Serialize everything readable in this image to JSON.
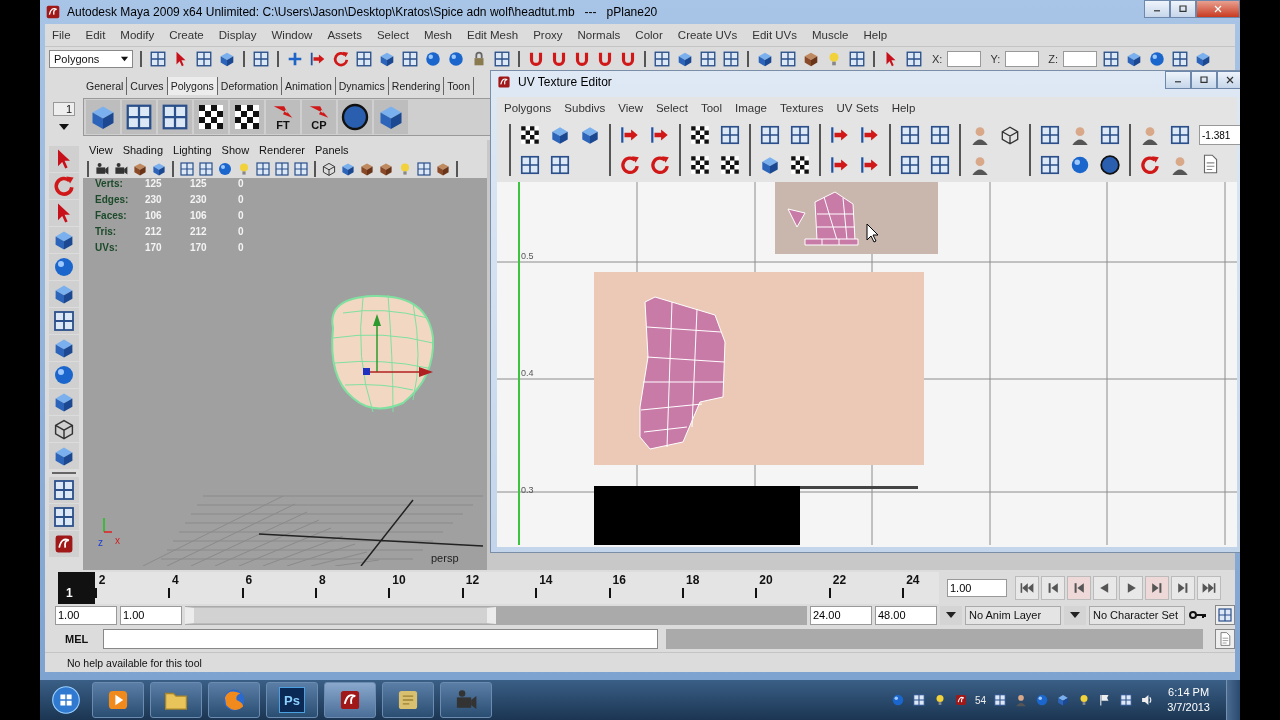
{
  "window": {
    "title": "Autodesk Maya 2009 x64 Unlimited: C:\\Users\\Jason\\Desktop\\Kratos\\Spice adn wolf\\headtut.mb   ---   pPlane20"
  },
  "menu": [
    "File",
    "Edit",
    "Modify",
    "Create",
    "Display",
    "Window",
    "Assets",
    "Select",
    "Mesh",
    "Edit Mesh",
    "Proxy",
    "Normals",
    "Color",
    "Create UVs",
    "Edit UVs",
    "Muscle",
    "Help"
  ],
  "status_line": {
    "menu_set": "Polygons",
    "fields": [
      {
        "label": "X:"
      },
      {
        "label": "Y:"
      },
      {
        "label": "Z:"
      }
    ]
  },
  "shelf": {
    "number": "1",
    "tabs": [
      {
        "label": "General",
        "selected": false
      },
      {
        "label": "Curves",
        "selected": false
      },
      {
        "label": "Polygons",
        "selected": true
      },
      {
        "label": "Deformation",
        "selected": false
      },
      {
        "label": "Animation",
        "selected": false
      },
      {
        "label": "Dynamics",
        "selected": false
      },
      {
        "label": "Rendering",
        "selected": false
      },
      {
        "label": "Toon",
        "selected": false
      }
    ],
    "tool_labels": [
      "FT",
      "CP"
    ]
  },
  "viewport": {
    "menu": [
      "View",
      "Shading",
      "Lighting",
      "Show",
      "Renderer",
      "Panels"
    ],
    "stats": [
      {
        "name": "Verts:",
        "values": [
          "125",
          "125",
          "0"
        ]
      },
      {
        "name": "Edges:",
        "values": [
          "230",
          "230",
          "0"
        ]
      },
      {
        "name": "Faces:",
        "values": [
          "106",
          "106",
          "0"
        ]
      },
      {
        "name": "Tris:",
        "values": [
          "212",
          "212",
          "0"
        ]
      },
      {
        "name": "UVs:",
        "values": [
          "170",
          "170",
          "0"
        ]
      }
    ],
    "camera": "persp",
    "axes": [
      "z",
      "x"
    ]
  },
  "uv_editor": {
    "title": "UV Texture Editor",
    "menu": [
      "Polygons",
      "Subdivs",
      "View",
      "Select",
      "Tool",
      "Image",
      "Textures",
      "UV Sets",
      "Help"
    ],
    "value": "-1.381",
    "axis_labels": [
      "0.5",
      "0.4",
      "0.3"
    ]
  },
  "time_slider": {
    "current_frame": "1",
    "level": 0,
    "ticks": [
      "2",
      "4",
      "6",
      "8",
      "10",
      "12",
      "14",
      "16",
      "18",
      "20",
      "22",
      "24"
    ],
    "current_time": "1.00"
  },
  "range_slider": {
    "level": 0.5,
    "start": "1.00",
    "range_start": "1.00",
    "range_end": "24.00",
    "end": "48.00",
    "anim_layer": "No Anim Layer",
    "character_set": "No Character Set"
  },
  "command_line": {
    "label": "MEL"
  },
  "help_line": "No help available for this tool",
  "taskbar": {
    "apps": [
      {
        "kind": "media"
      },
      {
        "kind": "folder"
      },
      {
        "kind": "browser"
      },
      {
        "kind": "photoshop",
        "label": "Ps"
      },
      {
        "kind": "maya"
      },
      {
        "kind": "notes"
      },
      {
        "kind": "camcorder"
      }
    ],
    "tray_badge": "54",
    "time": "6:14 PM",
    "date": "3/7/2013"
  }
}
